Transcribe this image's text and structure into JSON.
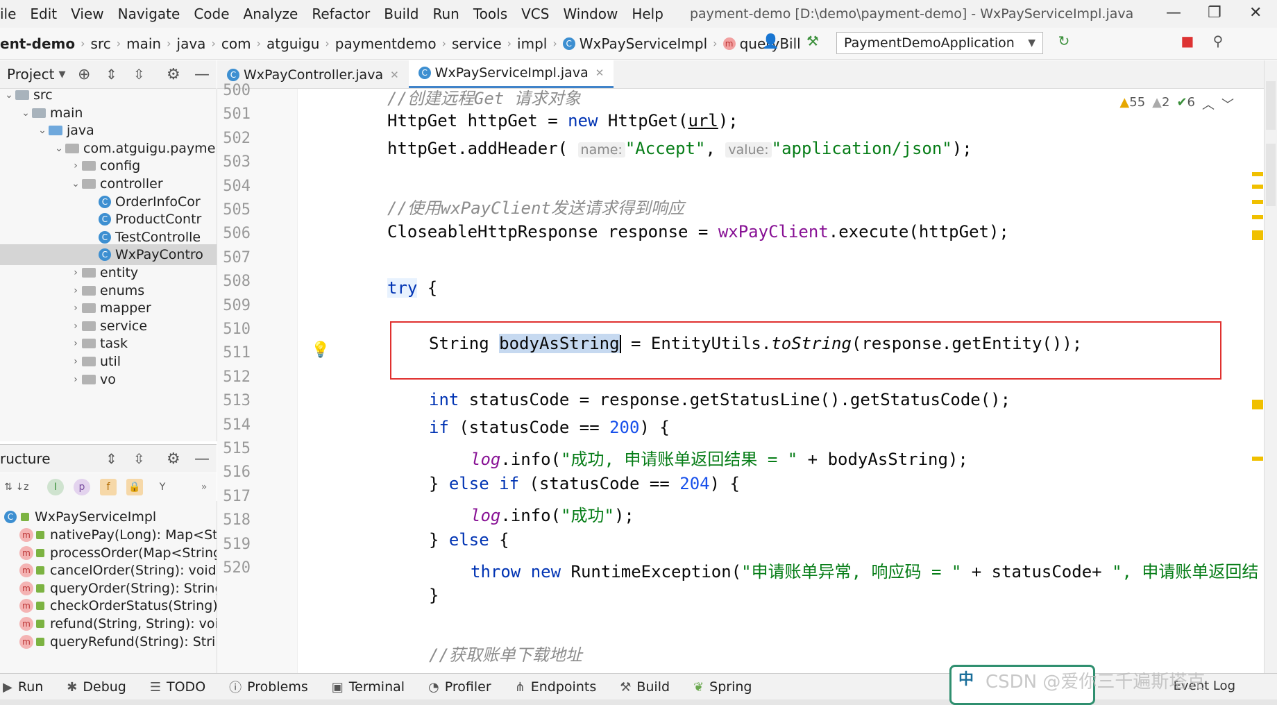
{
  "menubar": {
    "items": [
      "ile",
      "Edit",
      "View",
      "Navigate",
      "Code",
      "Analyze",
      "Refactor",
      "Build",
      "Run",
      "Tools",
      "VCS",
      "Window",
      "Help"
    ],
    "window_title": "payment-demo [D:\\demo\\payment-demo] - WxPayServiceImpl.java"
  },
  "navbar": {
    "breadcrumbs": [
      "ent-demo",
      "src",
      "main",
      "java",
      "com",
      "atguigu",
      "paymentdemo",
      "service",
      "impl",
      "WxPayServiceImpl",
      "queryBill"
    ],
    "run_config": "PaymentDemoApplication"
  },
  "project_panel": {
    "title": "Project",
    "tree": [
      {
        "label": "src",
        "depth": 0,
        "kind": "folder",
        "expanded": true
      },
      {
        "label": "main",
        "depth": 1,
        "kind": "folder",
        "expanded": true
      },
      {
        "label": "java",
        "depth": 2,
        "kind": "folder-blue",
        "expanded": true
      },
      {
        "label": "com.atguigu.payme",
        "depth": 3,
        "kind": "pkg",
        "expanded": true
      },
      {
        "label": "config",
        "depth": 4,
        "kind": "pkg",
        "expanded": false
      },
      {
        "label": "controller",
        "depth": 4,
        "kind": "pkg",
        "expanded": true
      },
      {
        "label": "OrderInfoCor",
        "depth": 5,
        "kind": "class"
      },
      {
        "label": "ProductContr",
        "depth": 5,
        "kind": "class"
      },
      {
        "label": "TestControlle",
        "depth": 5,
        "kind": "class"
      },
      {
        "label": "WxPayContro",
        "depth": 5,
        "kind": "class",
        "selected": true
      },
      {
        "label": "entity",
        "depth": 4,
        "kind": "pkg",
        "expanded": false
      },
      {
        "label": "enums",
        "depth": 4,
        "kind": "pkg",
        "expanded": false
      },
      {
        "label": "mapper",
        "depth": 4,
        "kind": "pkg",
        "expanded": false
      },
      {
        "label": "service",
        "depth": 4,
        "kind": "pkg",
        "expanded": false
      },
      {
        "label": "task",
        "depth": 4,
        "kind": "pkg",
        "expanded": false
      },
      {
        "label": "util",
        "depth": 4,
        "kind": "pkg",
        "expanded": false
      },
      {
        "label": "vo",
        "depth": 4,
        "kind": "pkg",
        "expanded": false
      }
    ]
  },
  "structure_panel": {
    "title": "ructure",
    "root": "WxPayServiceImpl",
    "methods": [
      "nativePay(Long): Map<Str",
      "processOrder(Map<String",
      "cancelOrder(String): void",
      "queryOrder(String): String",
      "checkOrderStatus(String):",
      "refund(String, String): void",
      "queryRefund(String): String"
    ]
  },
  "tabs": [
    {
      "label": "WxPayController.java",
      "active": false
    },
    {
      "label": "WxPayServiceImpl.java",
      "active": true
    }
  ],
  "editor": {
    "line_numbers": [
      "500",
      "501",
      "502",
      "503",
      "504",
      "505",
      "506",
      "507",
      "508",
      "509",
      "510",
      "511",
      "512",
      "513",
      "514",
      "515",
      "516",
      "517",
      "518",
      "519",
      "520"
    ],
    "code": {
      "l500": "//创建远程Get 请求对象",
      "l501_a": "HttpGet httpGet = ",
      "l501_kw": "new",
      "l501_b": " HttpGet(",
      "l501_url": "url",
      "l501_c": ");",
      "l502_a": "httpGet.addHeader(",
      "l502_hint1": "name:",
      "l502_s1": "\"Accept\"",
      "l502_b": ", ",
      "l502_hint2": "value:",
      "l502_s2": "\"application/json\"",
      "l502_c": ");",
      "l504": "//使用wxPayClient发送请求得到响应",
      "l505_a": "CloseableHttpResponse response = ",
      "l505_fld": "wxPayClient",
      "l505_b": ".execute(httpGet);",
      "l507_kw": "try",
      "l507_b": " {",
      "l509_a": "String ",
      "l509_sel": "bodyAsString",
      "l509_b": " = EntityUtils.",
      "l509_it": "toString",
      "l509_c": "(response.getEntity());",
      "l511_kw": "int",
      "l511_b": " statusCode = response.getStatusLine().getStatusCode();",
      "l512_kw": "if",
      "l512_b": " (statusCode == ",
      "l512_num": "200",
      "l512_c": ") {",
      "l513_log": "log",
      "l513_b": ".info(",
      "l513_s": "\"成功, 申请账单返回结果 = \"",
      "l513_c": " + bodyAsString);",
      "l514_a": "} ",
      "l514_kw": "else if",
      "l514_b": " (statusCode == ",
      "l514_num": "204",
      "l514_c": ") {",
      "l515_log": "log",
      "l515_b": ".info(",
      "l515_s": "\"成功\"",
      "l515_c": ");",
      "l516_a": "} ",
      "l516_kw": "else",
      "l516_b": " {",
      "l517_kw": "throw",
      "l517_sp": " ",
      "l517_kw2": "new",
      "l517_b": " RuntimeException(",
      "l517_s": "\"申请账单异常, 响应码 = \"",
      "l517_c": " + statusCode+ ",
      "l517_s2": "\", 申请账单返回结",
      "l518": "}",
      "l520": "//获取账单下载地址"
    },
    "inspections": {
      "warnings": "55",
      "weak_warnings": "2",
      "ok": "6"
    }
  },
  "bottom_bar": {
    "items": [
      "Run",
      "Debug",
      "TODO",
      "Problems",
      "Terminal",
      "Profiler",
      "Endpoints",
      "Build",
      "Spring"
    ],
    "event_log": "Event Log"
  },
  "watermark": {
    "line1": "中",
    "csdn": "CSDN @爱你三千遍斯塔克"
  },
  "colors": {
    "keyword": "#0033b3",
    "string": "#067d17",
    "number": "#1750eb",
    "comment": "#8c8c8c",
    "field": "#871094",
    "highlight_box": "#e0302e"
  }
}
